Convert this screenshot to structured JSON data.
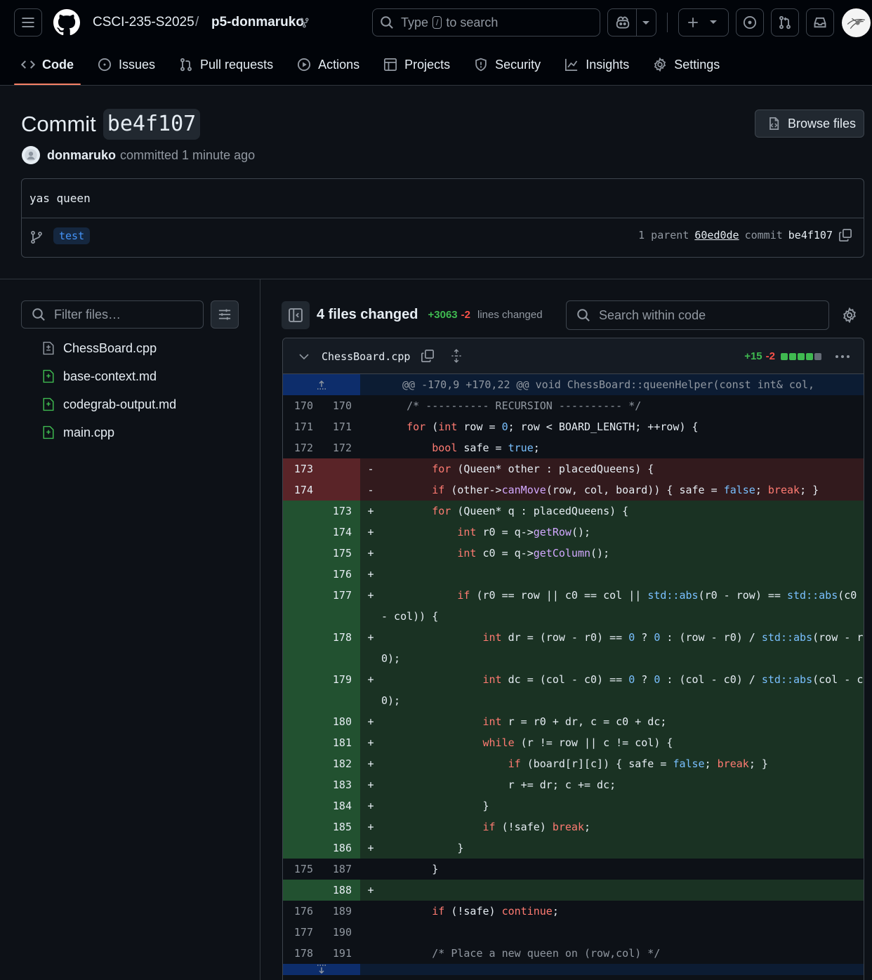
{
  "header": {
    "org": "CSCI-235-S2025",
    "sep": "/",
    "repo": "p5-donmaruko",
    "search_prefix": "Type",
    "search_key": "/",
    "search_suffix": "to search"
  },
  "nav": [
    {
      "label": "Code",
      "icon": "code-icon",
      "active": true
    },
    {
      "label": "Issues",
      "icon": "issue-icon"
    },
    {
      "label": "Pull requests",
      "icon": "pull-request-icon"
    },
    {
      "label": "Actions",
      "icon": "play-icon"
    },
    {
      "label": "Projects",
      "icon": "table-icon"
    },
    {
      "label": "Security",
      "icon": "shield-icon"
    },
    {
      "label": "Insights",
      "icon": "graph-icon"
    },
    {
      "label": "Settings",
      "icon": "gear-icon"
    }
  ],
  "commit": {
    "title_word": "Commit",
    "sha_short": "be4f107",
    "browse_label": "Browse files",
    "author": "donmaruko",
    "when": "committed 1 minute ago",
    "message": "yas queen",
    "branch": "test",
    "parent_label": "1 parent",
    "parent_sha": "60ed0de",
    "commit_label": "commit",
    "commit_sha": "be4f107"
  },
  "filetree": {
    "filter_placeholder": "Filter files…",
    "files": [
      "ChessBoard.cpp",
      "base-context.md",
      "codegrab-output.md",
      "main.cpp"
    ]
  },
  "summary": {
    "files_changed": "4 files changed",
    "additions": "+3063",
    "deletions": "-2",
    "lines_label": "lines changed",
    "search_placeholder": "Search within code"
  },
  "file": {
    "name": "ChessBoard.cpp",
    "additions": "+15",
    "deletions": "-2",
    "stat_blocks": [
      "#3fb950",
      "#3fb950",
      "#3fb950",
      "#3fb950",
      "#656c76"
    ]
  },
  "diff": [
    {
      "t": "hunk",
      "o": "",
      "n": "",
      "text": "@@ -170,9 +170,22 @@ void ChessBoard::queenHelper(const int& col,"
    },
    {
      "t": "ctx",
      "o": "170",
      "n": "170",
      "text": "    /* ---------- RECURSION ---------- */"
    },
    {
      "t": "ctx",
      "o": "171",
      "n": "171",
      "text": "    for (int row = 0; row < BOARD_LENGTH; ++row) {"
    },
    {
      "t": "ctx",
      "o": "172",
      "n": "172",
      "text": "        bool safe = true;"
    },
    {
      "t": "del",
      "o": "173",
      "n": "",
      "text": "        for (Queen* other : placedQueens) {"
    },
    {
      "t": "del",
      "o": "174",
      "n": "",
      "text": "        if (other->canMove(row, col, board)) { safe = false; break; }"
    },
    {
      "t": "add",
      "o": "",
      "n": "173",
      "text": "        for (Queen* q : placedQueens) {"
    },
    {
      "t": "add",
      "o": "",
      "n": "174",
      "text": "            int r0 = q->getRow();"
    },
    {
      "t": "add",
      "o": "",
      "n": "175",
      "text": "            int c0 = q->getColumn();"
    },
    {
      "t": "add",
      "o": "",
      "n": "176",
      "text": ""
    },
    {
      "t": "add",
      "o": "",
      "n": "177",
      "text": "            if (r0 == row || c0 == col || std::abs(r0 - row) == std::abs(c0 - col)) {"
    },
    {
      "t": "add",
      "o": "",
      "n": "178",
      "text": "                int dr = (row - r0) == 0 ? 0 : (row - r0) / std::abs(row - r0);"
    },
    {
      "t": "add",
      "o": "",
      "n": "179",
      "text": "                int dc = (col - c0) == 0 ? 0 : (col - c0) / std::abs(col - c0);"
    },
    {
      "t": "add",
      "o": "",
      "n": "180",
      "text": "                int r = r0 + dr, c = c0 + dc;"
    },
    {
      "t": "add",
      "o": "",
      "n": "181",
      "text": "                while (r != row || c != col) {"
    },
    {
      "t": "add",
      "o": "",
      "n": "182",
      "text": "                    if (board[r][c]) { safe = false; break; }"
    },
    {
      "t": "add",
      "o": "",
      "n": "183",
      "text": "                    r += dr; c += dc;"
    },
    {
      "t": "add",
      "o": "",
      "n": "184",
      "text": "                }"
    },
    {
      "t": "add",
      "o": "",
      "n": "185",
      "text": "                if (!safe) break;"
    },
    {
      "t": "add",
      "o": "",
      "n": "186",
      "text": "            }"
    },
    {
      "t": "ctx",
      "o": "175",
      "n": "187",
      "text": "        }"
    },
    {
      "t": "add",
      "o": "",
      "n": "188",
      "text": ""
    },
    {
      "t": "ctx",
      "o": "176",
      "n": "189",
      "text": "        if (!safe) continue;"
    },
    {
      "t": "ctx",
      "o": "177",
      "n": "190",
      "text": ""
    },
    {
      "t": "ctx",
      "o": "178",
      "n": "191",
      "text": "        /* Place a new queen on (row,col) */"
    },
    {
      "t": "hunk",
      "o": "",
      "n": "",
      "text": ""
    }
  ]
}
